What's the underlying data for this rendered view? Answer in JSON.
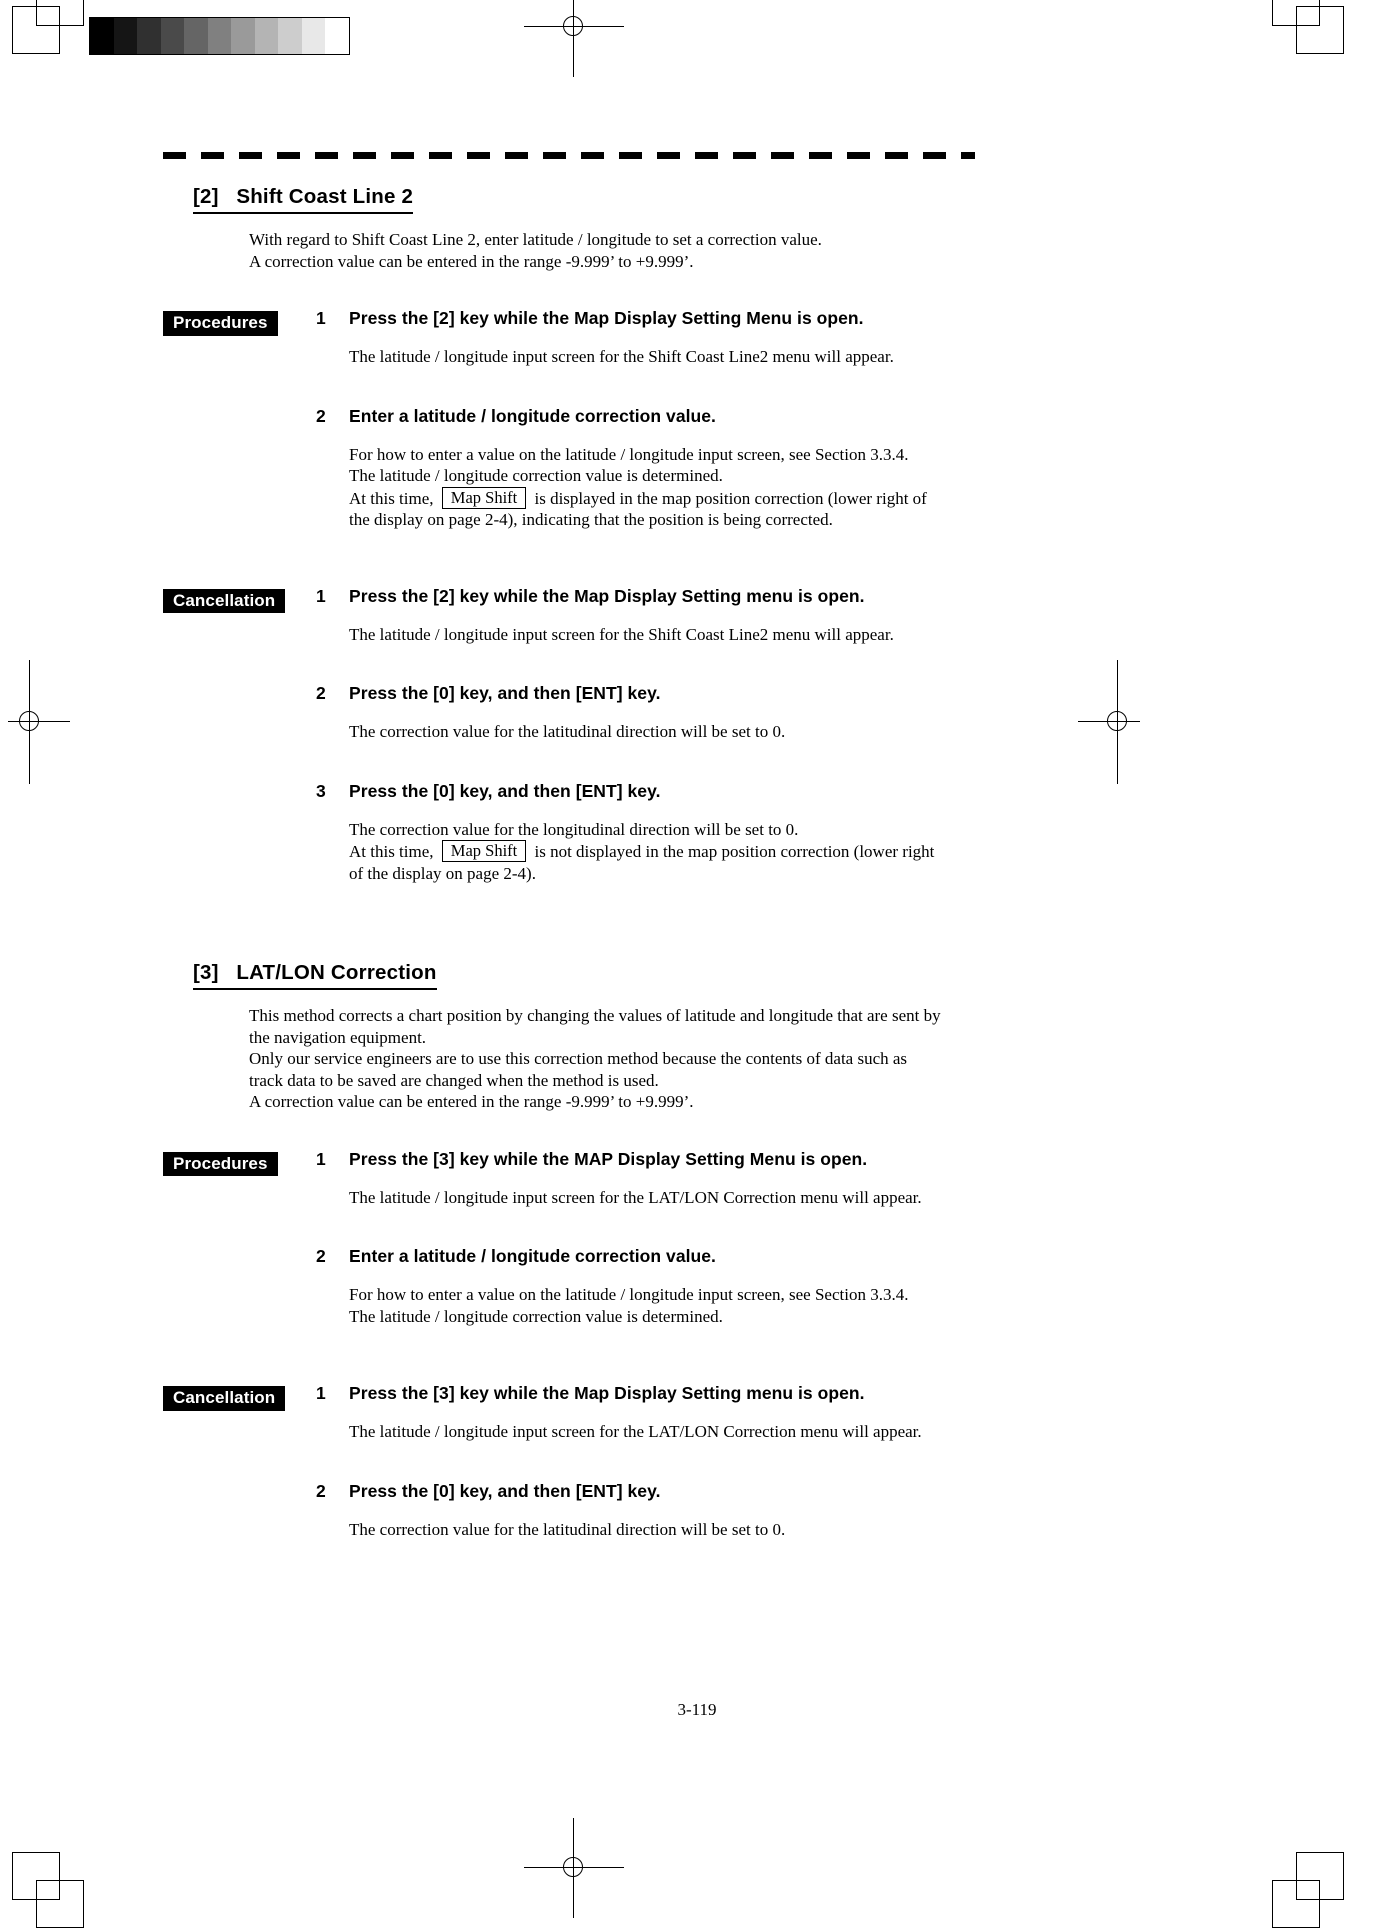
{
  "page": {
    "folio": "3-119",
    "grayscale_steps": [
      "#000000",
      "#151515",
      "#303030",
      "#4a4a4a",
      "#656565",
      "#808080",
      "#9a9a9a",
      "#b4b4b4",
      "#cdcdcd",
      "#e8e8e8",
      "#ffffff"
    ]
  },
  "sections": [
    {
      "heading": "[2]   Shift Coast Line 2",
      "intro": "With regard to Shift Coast Line 2, enter latitude / longitude to set a correction value.\nA correction value can be entered in the range -9.999’ to +9.999’.",
      "groups": [
        {
          "badge": "Procedures",
          "steps": [
            {
              "num": "1",
              "title": "Press the [2] key while the Map Display Setting Menu is open.",
              "body": "The latitude / longitude input screen for the Shift Coast Line2 menu will appear."
            },
            {
              "num": "2",
              "title": "Enter a latitude / longitude correction value.",
              "body_pre": "For how to enter a value on the latitude / longitude input screen, see Section 3.3.4.\nThe latitude / longitude correction value is determined.\nAt this time, ",
              "body_box": "Map Shift",
              "body_post": " is displayed in the map position correction (lower right of\nthe display on page 2-4), indicating that the position is being corrected."
            }
          ]
        },
        {
          "badge": "Cancellation",
          "steps": [
            {
              "num": "1",
              "title": "Press the [2] key while the Map Display Setting menu is open.",
              "body": "The latitude / longitude input screen for the Shift Coast Line2 menu will appear."
            },
            {
              "num": "2",
              "title": "Press the [0] key, and then [ENT] key.",
              "body": "The correction value for the latitudinal direction will be set to 0."
            },
            {
              "num": "3",
              "title": "Press the [0] key, and then [ENT] key.",
              "body_pre": "The correction value for the longitudinal direction will be set to 0.\nAt this time, ",
              "body_box": "Map Shift",
              "body_post": " is not displayed in the map position correction (lower right\nof the display on page 2-4)."
            }
          ]
        }
      ]
    },
    {
      "heading": "[3]   LAT/LON Correction",
      "intro": "This method corrects a chart position by changing the values of latitude and longitude that are sent by\nthe navigation equipment.\nOnly our service engineers are to use this correction method because the contents of data such as\ntrack data to be saved are changed when the method is used.\nA correction value can be entered in the range -9.999’ to +9.999’.",
      "groups": [
        {
          "badge": "Procedures",
          "steps": [
            {
              "num": "1",
              "title": "Press the [3] key while the MAP Display Setting Menu is open.",
              "body": "The latitude / longitude input screen for the LAT/LON Correction menu will appear."
            },
            {
              "num": "2",
              "title": "Enter a latitude / longitude correction value.",
              "body": "For how to enter a value on the latitude / longitude input screen, see Section 3.3.4.\nThe latitude / longitude correction value is determined."
            }
          ]
        },
        {
          "badge": "Cancellation",
          "steps": [
            {
              "num": "1",
              "title": "Press the [3] key while the Map Display Setting menu is open.",
              "body": "The latitude / longitude input screen for the LAT/LON Correction menu will appear."
            },
            {
              "num": "2",
              "title": "Press the [0] key, and then [ENT] key.",
              "body": "The correction value for the latitudinal direction will be set to 0."
            }
          ]
        }
      ]
    }
  ]
}
